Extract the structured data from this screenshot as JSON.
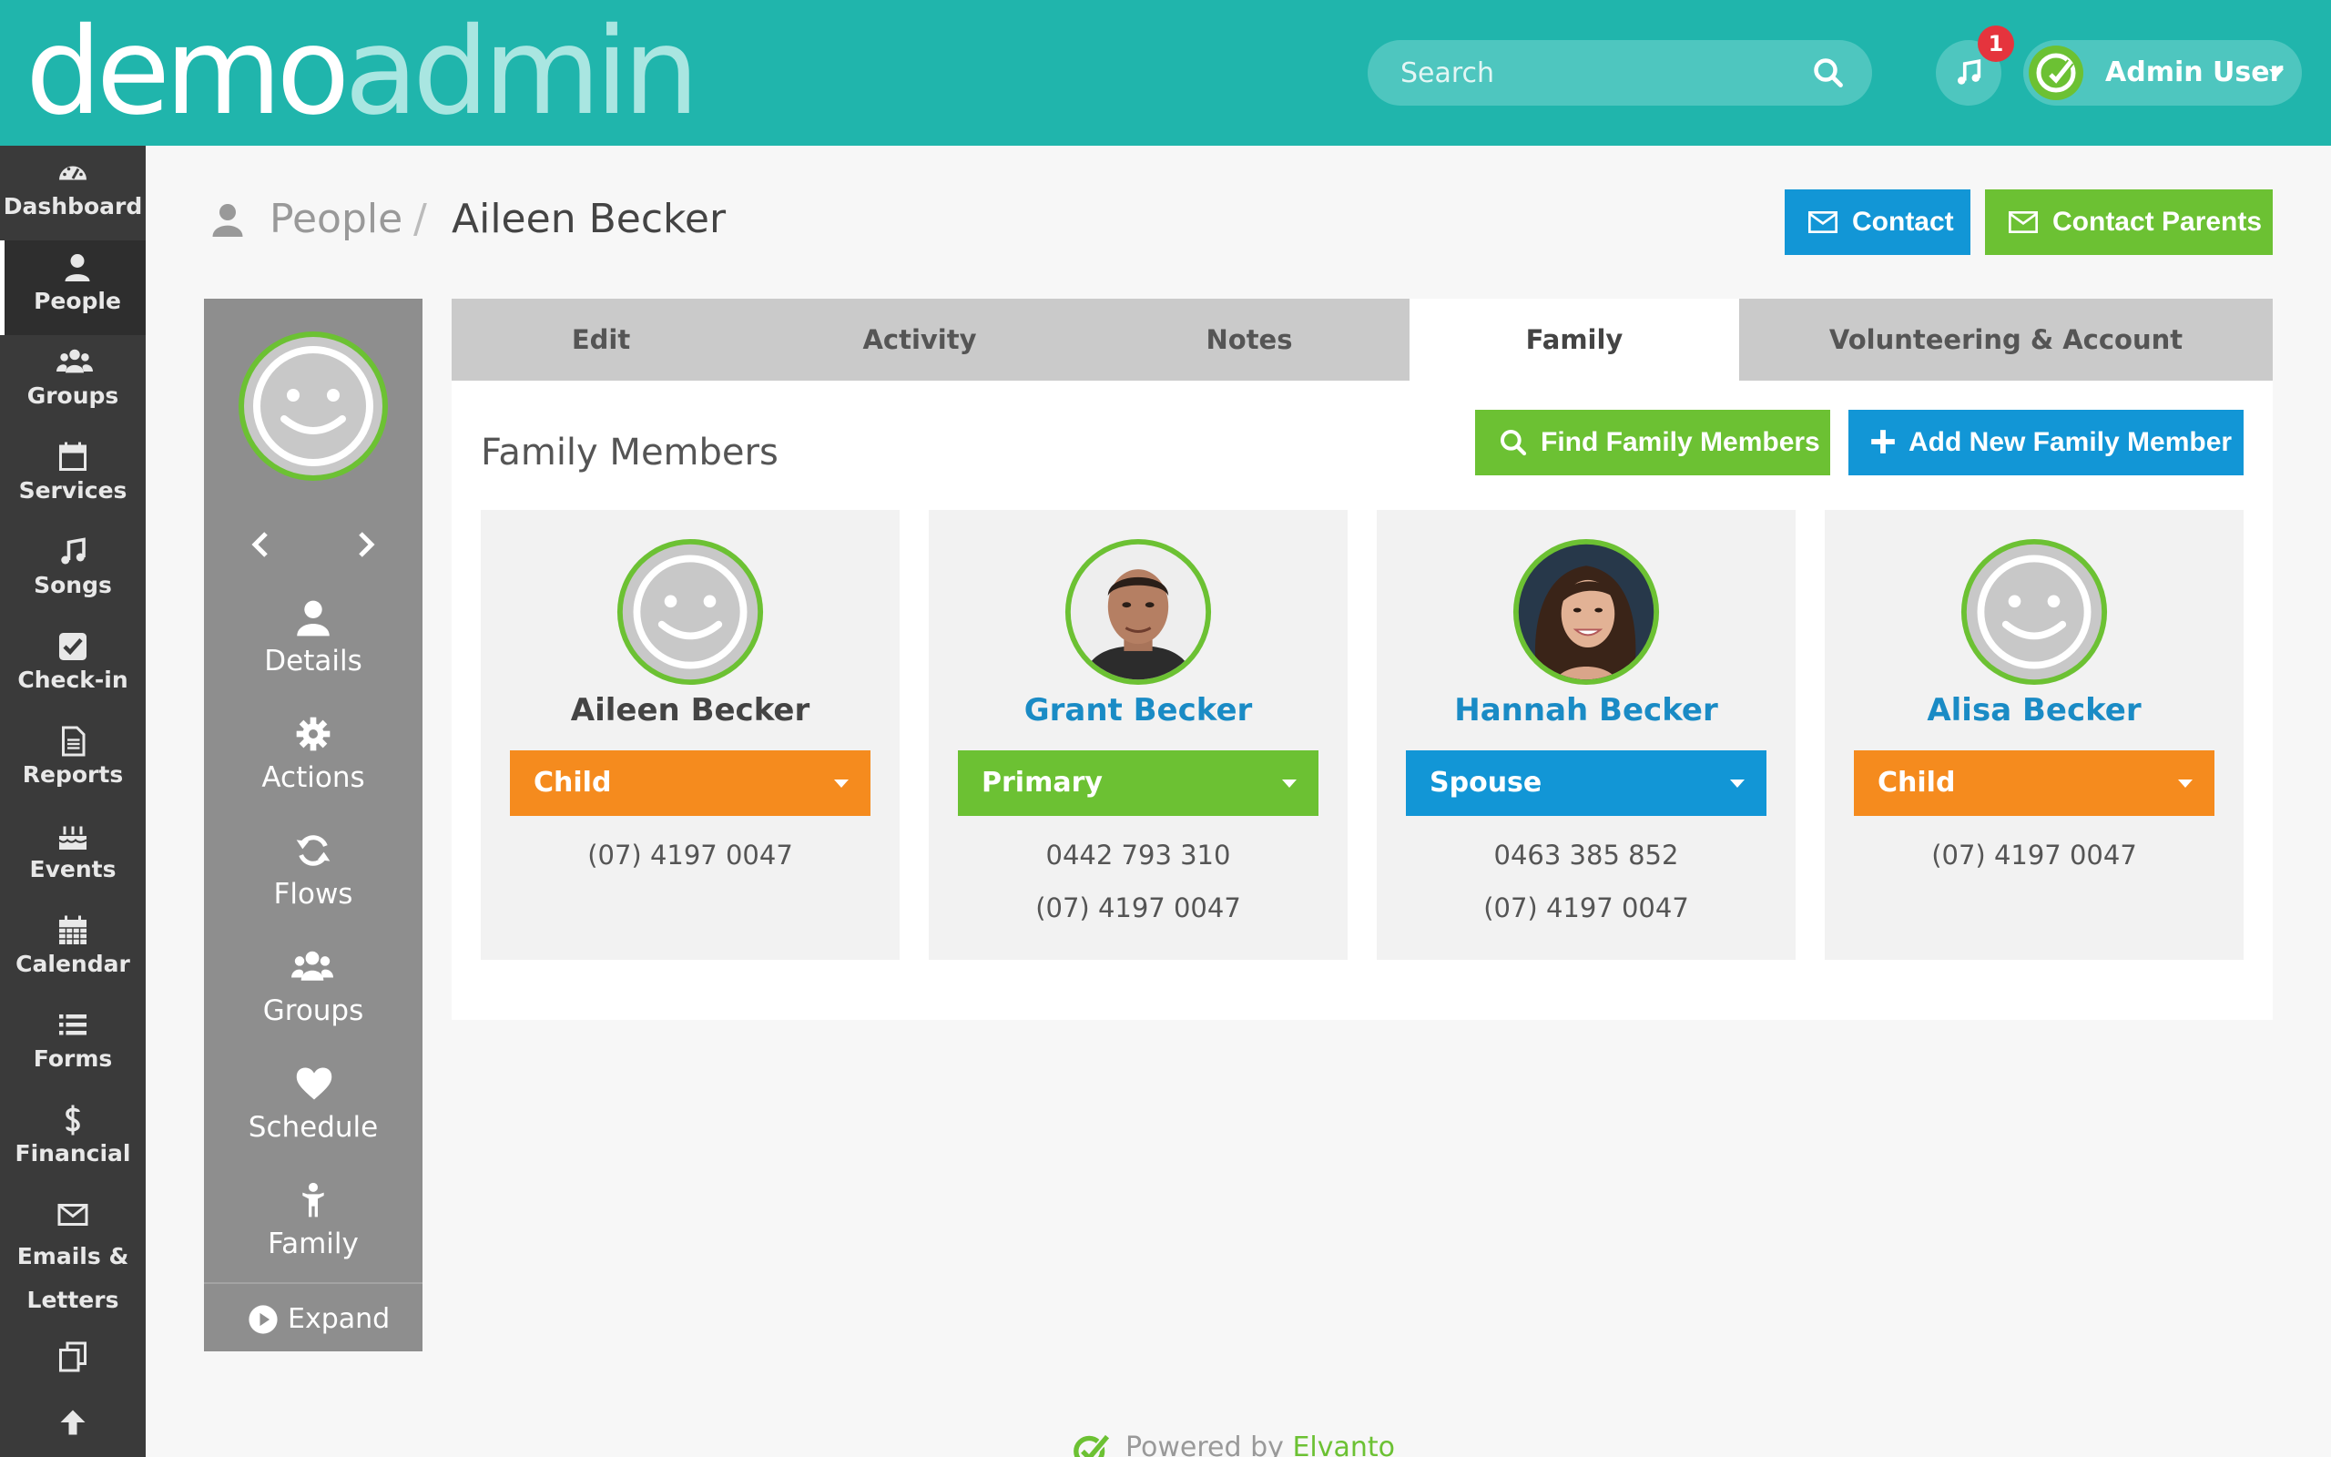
{
  "header": {
    "logo_part1": "demo",
    "logo_part2": "admin",
    "search_placeholder": "Search",
    "notification_count": "1",
    "user_name": "Admin User"
  },
  "nav": {
    "items": [
      {
        "label": "Dashboard",
        "icon": "dashboard-icon"
      },
      {
        "label": "People",
        "icon": "person-icon"
      },
      {
        "label": "Groups",
        "icon": "groups-icon"
      },
      {
        "label": "Services",
        "icon": "calendar-icon"
      },
      {
        "label": "Songs",
        "icon": "music-icon"
      },
      {
        "label": "Check-in",
        "icon": "check-square-icon"
      },
      {
        "label": "Reports",
        "icon": "document-icon"
      },
      {
        "label": "Events",
        "icon": "cake-icon"
      },
      {
        "label": "Calendar",
        "icon": "calendar-grid-icon"
      },
      {
        "label": "Forms",
        "icon": "list-icon"
      },
      {
        "label": "Financial",
        "icon": "dollar-icon"
      },
      {
        "label_line1": "Emails &",
        "label_line2": "Letters",
        "icon": "envelope-icon"
      }
    ]
  },
  "breadcrumb": {
    "parent": "People",
    "separator": "/",
    "current": "Aileen Becker"
  },
  "actions": {
    "contact": "Contact",
    "contact_parents": "Contact Parents"
  },
  "panel": {
    "items": [
      {
        "label": "Details"
      },
      {
        "label": "Actions"
      },
      {
        "label": "Flows"
      },
      {
        "label": "Groups"
      },
      {
        "label": "Schedule"
      },
      {
        "label": "Family"
      }
    ],
    "expand": "Expand"
  },
  "tabs": [
    {
      "label": "Edit"
    },
    {
      "label": "Activity"
    },
    {
      "label": "Notes"
    },
    {
      "label": "Family"
    },
    {
      "label": "Volunteering & Account"
    }
  ],
  "family": {
    "title": "Family Members",
    "find_button": "Find Family Members",
    "add_button": "Add New Family Member",
    "members": [
      {
        "name": "Aileen Becker",
        "role": "Child",
        "phones": [
          "(07) 4197 0047"
        ]
      },
      {
        "name": "Grant Becker",
        "role": "Primary",
        "phones": [
          "0442 793 310",
          "(07) 4197 0047"
        ]
      },
      {
        "name": "Hannah Becker",
        "role": "Spouse",
        "phones": [
          "0463 385 852",
          "(07) 4197 0047"
        ]
      },
      {
        "name": "Alisa Becker",
        "role": "Child",
        "phones": [
          "(07) 4197 0047"
        ]
      }
    ]
  },
  "footer": {
    "prefix": "Powered by",
    "brand": "Elvanto"
  },
  "colors": {
    "header_teal": "#20b5ac",
    "primary_blue": "#1296d6",
    "success_green": "#6cc133",
    "child_orange": "#f58b1e",
    "nav_dark": "#3a3a3a",
    "badge_red": "#e5343d"
  }
}
